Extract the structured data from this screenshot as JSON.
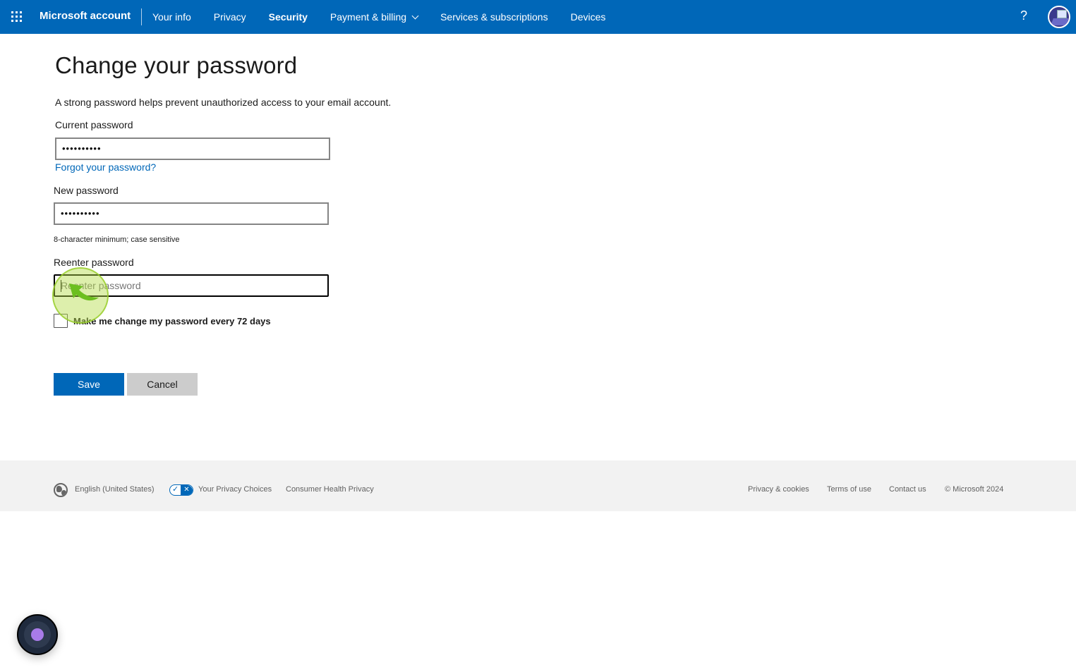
{
  "header": {
    "app_title": "Microsoft account",
    "nav": [
      {
        "label": "Your info",
        "active": false
      },
      {
        "label": "Privacy",
        "active": false
      },
      {
        "label": "Security",
        "active": true
      },
      {
        "label": "Payment & billing",
        "active": false,
        "has_dropdown": true
      },
      {
        "label": "Services & subscriptions",
        "active": false
      },
      {
        "label": "Devices",
        "active": false
      }
    ],
    "help_label": "?",
    "icons": {
      "apps": "waffle-grid-icon",
      "help": "question-mark-icon",
      "avatar": "user-avatar"
    },
    "brand_color": "#0067b8"
  },
  "form": {
    "title": "Change your password",
    "description": "A strong password helps prevent unauthorized access to your email account.",
    "current_password": {
      "label": "Current password",
      "value": "••••••••••"
    },
    "forgot_link": "Forgot your password?",
    "new_password": {
      "label": "New password",
      "value": "••••••••••",
      "hint": "8-character minimum; case sensitive"
    },
    "reenter_password": {
      "label": "Reenter password",
      "value": "",
      "placeholder": "Reenter password"
    },
    "checkbox": {
      "label": "Make me change my password every 72 days",
      "checked": false
    },
    "save_label": "Save",
    "cancel_label": "Cancel"
  },
  "footer": {
    "language": "English (United States)",
    "privacy_choices": "Your Privacy Choices",
    "consumer_health": "Consumer Health Privacy",
    "links": [
      "Privacy & cookies",
      "Terms of use",
      "Contact us"
    ],
    "copyright": "© Microsoft 2024"
  },
  "toggle_glyphs": {
    "check": "✓",
    "cross": "✕"
  }
}
